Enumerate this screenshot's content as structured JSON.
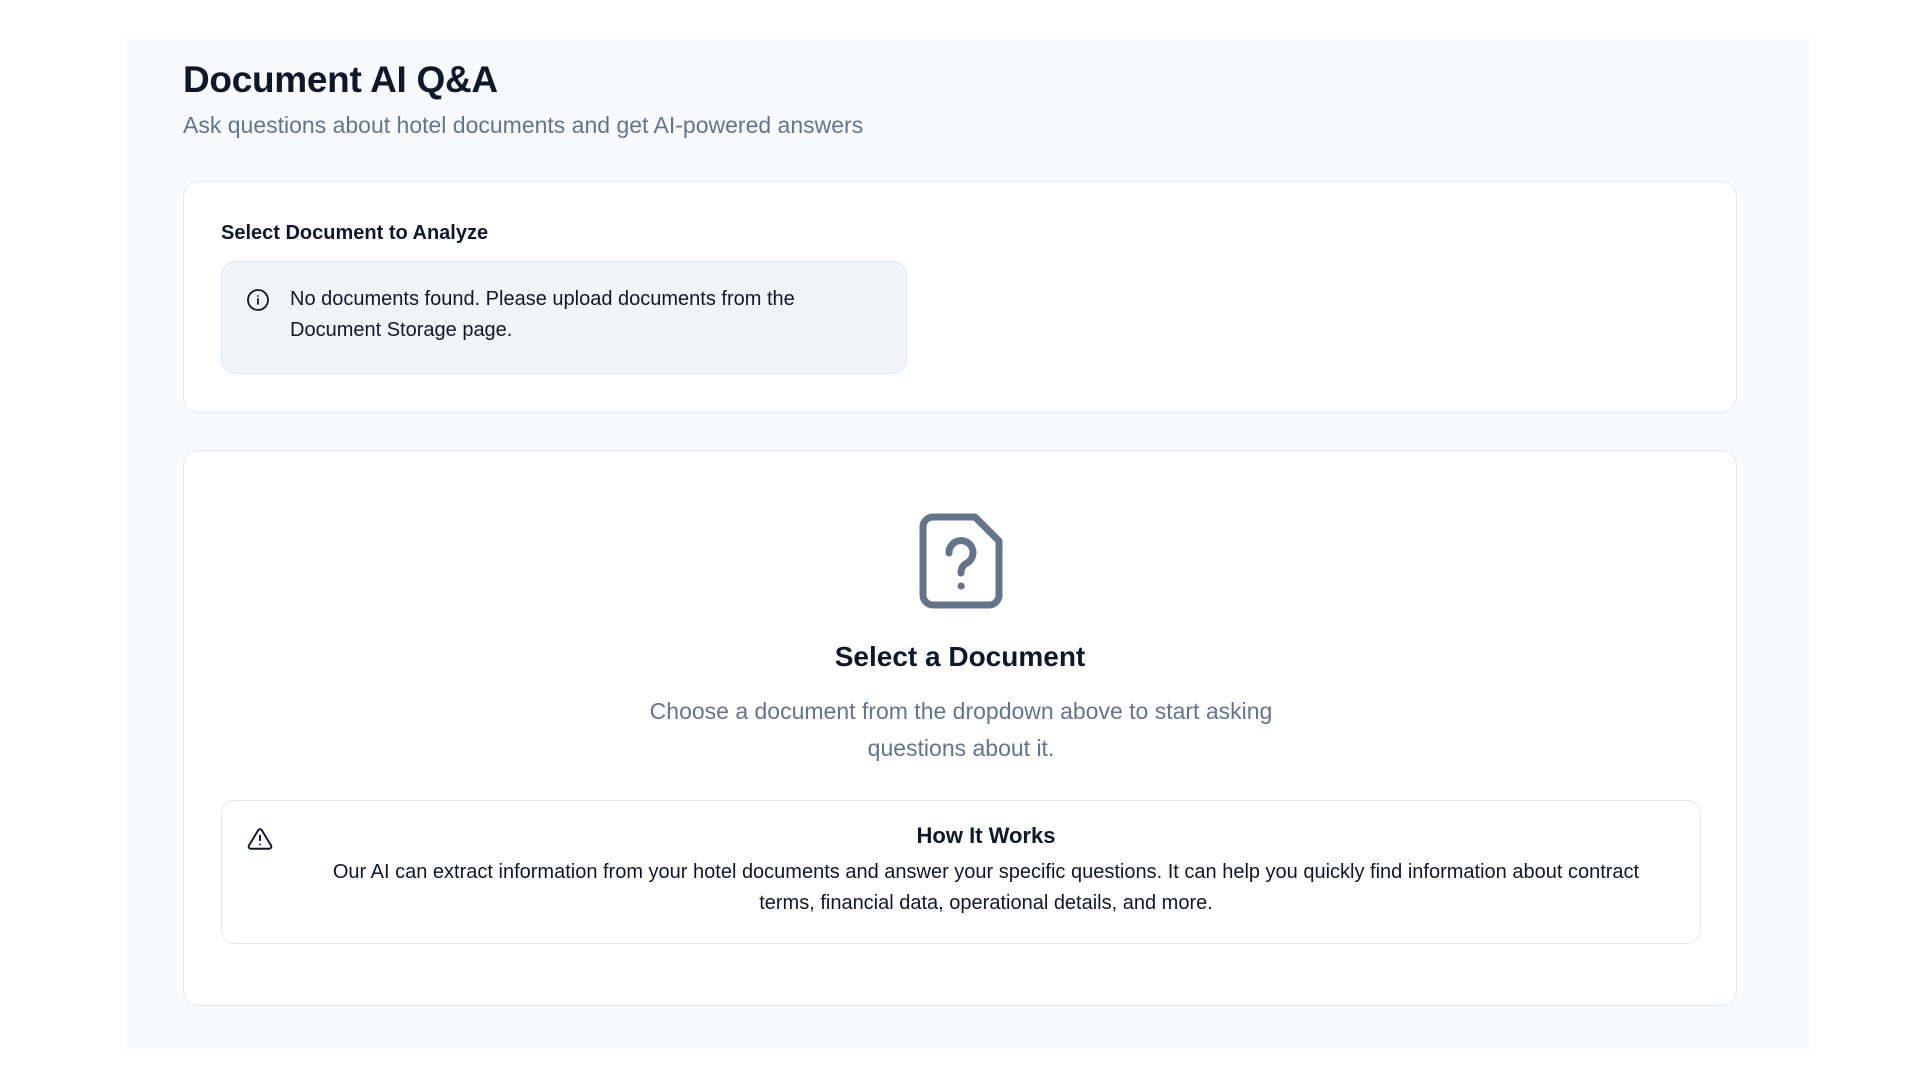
{
  "header": {
    "title": "Document AI Q&A",
    "subtitle": "Ask questions about hotel documents and get AI-powered answers"
  },
  "document_select": {
    "label": "Select Document to Analyze",
    "alert": {
      "icon": "info-icon",
      "text": "No documents found. Please upload documents from the Document Storage page."
    }
  },
  "empty_state": {
    "icon": "file-question-icon",
    "title": "Select a Document",
    "description": "Choose a document from the dropdown above to start asking questions about it."
  },
  "how_it_works": {
    "icon": "warning-triangle-icon",
    "title": "How It Works",
    "text": "Our AI can extract information from your hotel documents and answer your specific questions. It can help you quickly find information about contract terms, financial data, operational details, and more."
  },
  "colors": {
    "page_bg": "#f8fafc",
    "card_bg": "#ffffff",
    "border": "#e2e8f0",
    "alert_bg": "#f1f5f9",
    "text_primary": "#0f172a",
    "text_muted": "#64748b",
    "icon": "#64748b"
  }
}
